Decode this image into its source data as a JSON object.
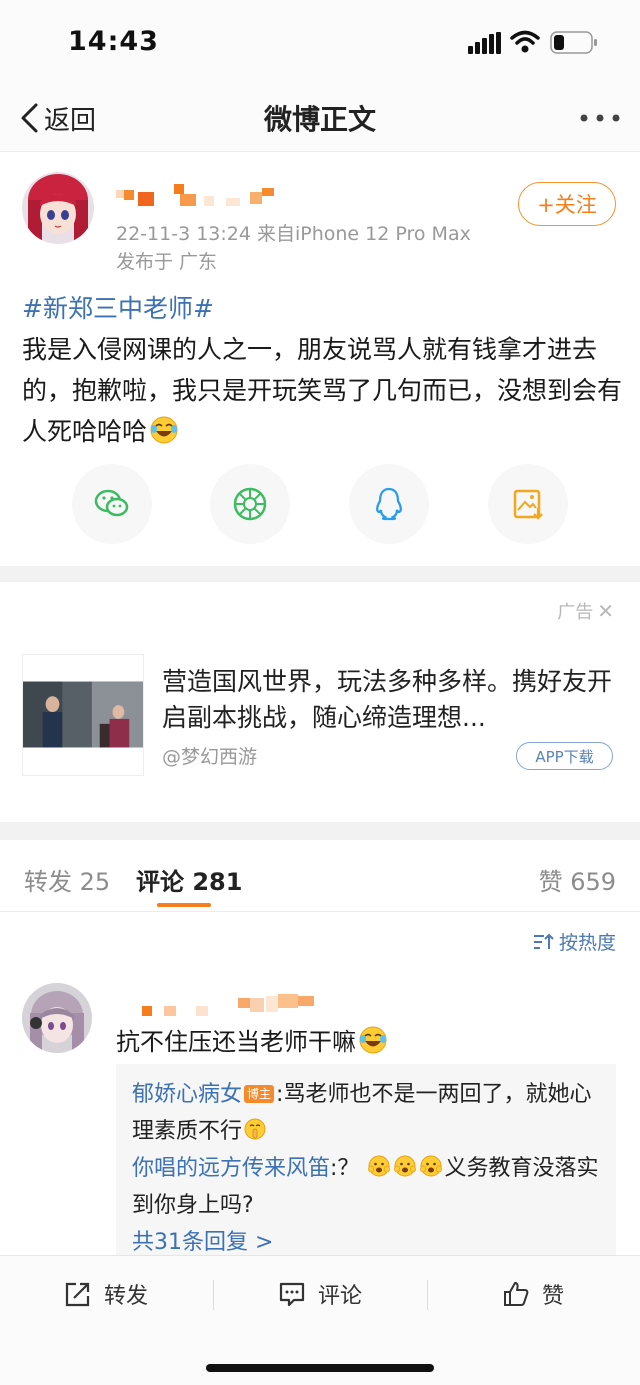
{
  "status_bar": {
    "time": "14:43"
  },
  "nav": {
    "back_label": "返回",
    "title": "微博正文"
  },
  "post": {
    "follow_label": "+关注",
    "meta": "22-11-3 13:24  来自iPhone 12 Pro Max",
    "location": "发布于 广东",
    "topic": "#新郑三中老师#",
    "body": "我是入侵网课的人之一，朋友说骂人就有钱拿才进去的，抱歉啦，我只是开玩笑骂了几句而已，没想到会有人死哈哈哈",
    "share_icons": [
      "wechat-icon",
      "moments-icon",
      "qq-icon",
      "save-image-icon"
    ]
  },
  "ad": {
    "label": "广告",
    "text": "营造国风世界，玩法多种多样。携好友开启副本挑战，随心缔造理想...",
    "source": "@梦幻西游",
    "button": "APP下载"
  },
  "tabs": [
    {
      "label": "转发 25"
    },
    {
      "label": "评论 281"
    },
    {
      "label": "赞 659"
    }
  ],
  "sort_label": "按热度",
  "comment": {
    "text": "抗不住压还当老师干嘛",
    "replies": [
      {
        "name": "郁娇心病女",
        "badge": "博主",
        "text": ":骂老师也不是一两回了，就她心理素质不行"
      },
      {
        "name": "你唱的远方传来风笛",
        "text_before": ":？",
        "text": "义务教育没落实到你身上吗?"
      }
    ],
    "more_replies": "共31条回复 >"
  },
  "bottom_bar": {
    "repost": "转发",
    "comment": "评论",
    "like": "赞"
  },
  "colors": {
    "accent": "#f77d1a",
    "link": "#3c71b3"
  }
}
